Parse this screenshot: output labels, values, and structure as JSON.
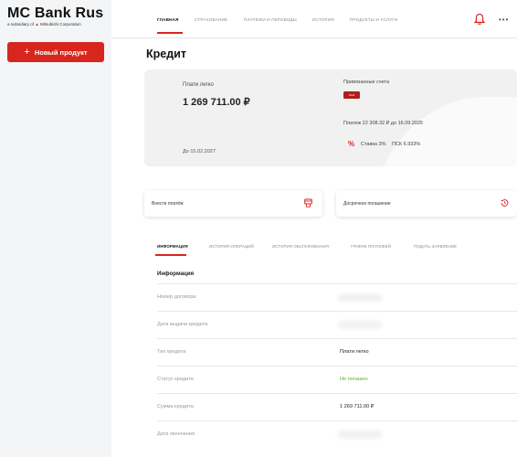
{
  "logo": {
    "title": "MC Bank Rus",
    "subtitle_prefix": "a subsidiary of ",
    "subtitle_brand": "Mitsubishi Corporation"
  },
  "sidebar": {
    "new_product_label": "Новый продукт",
    "new_product_icon": "plus-icon"
  },
  "nav": {
    "items": [
      "ГЛАВНАЯ",
      "СТРАХОВАНИЕ",
      "ПЛАТЕЖИ И ПЕРЕВОДЫ",
      "ИСТОРИЯ",
      "ПРОДУКТЫ И УСЛУГИ"
    ],
    "active_index": 0,
    "notifications_icon": "bell-icon",
    "more_icon": "more-dots-icon",
    "more_label": "•••"
  },
  "page": {
    "title": "Кредит"
  },
  "credit_card": {
    "label": "Плати легко",
    "amount": "1 269 711.00 ₽",
    "until": "До 15.02.2027",
    "linked_label": "Привязанные счета",
    "account_badge": "•9314",
    "payment": "Платеж 22 308.32 ₽ до 16.09.2025",
    "rate_icon": "%",
    "rate": "Ставка 3%",
    "psk": "ПСК 6.933%"
  },
  "actions": {
    "pay_label": "Внести платёж",
    "pay_icon": "payment-terminal-icon",
    "early_label": "Досрочное погашение",
    "early_icon": "clock-history-icon"
  },
  "tabs": {
    "items": [
      "ИНФОРМАЦИЯ",
      "ИСТОРИЯ ОПЕРАЦИЙ",
      "ИСТОРИЯ ОБСЛУЖИВАНИЯ",
      "ГРАФИК ПЛАТЕЖЕЙ",
      "ПОДАТЬ ЗАЯВЛЕНИЕ"
    ],
    "active_index": 0
  },
  "info": {
    "title": "Информация",
    "rows": [
      {
        "key": "Номер договора",
        "value": "",
        "hidden": true
      },
      {
        "key": "Дата выдачи кредита",
        "value": "",
        "hidden": true
      },
      {
        "key": "Тип кредита",
        "value": "Плати легко"
      },
      {
        "key": "Статус кредита",
        "value": "Не погашен",
        "status": "green"
      },
      {
        "key": "Сумма кредита",
        "value": "1 269 711.00 ₽"
      },
      {
        "key": "Дата окончания",
        "value": "",
        "hidden": true
      }
    ]
  },
  "colors": {
    "brand_red": "#d7261e",
    "status_green": "#4cb81d",
    "account_badge": "#b01e1a"
  }
}
